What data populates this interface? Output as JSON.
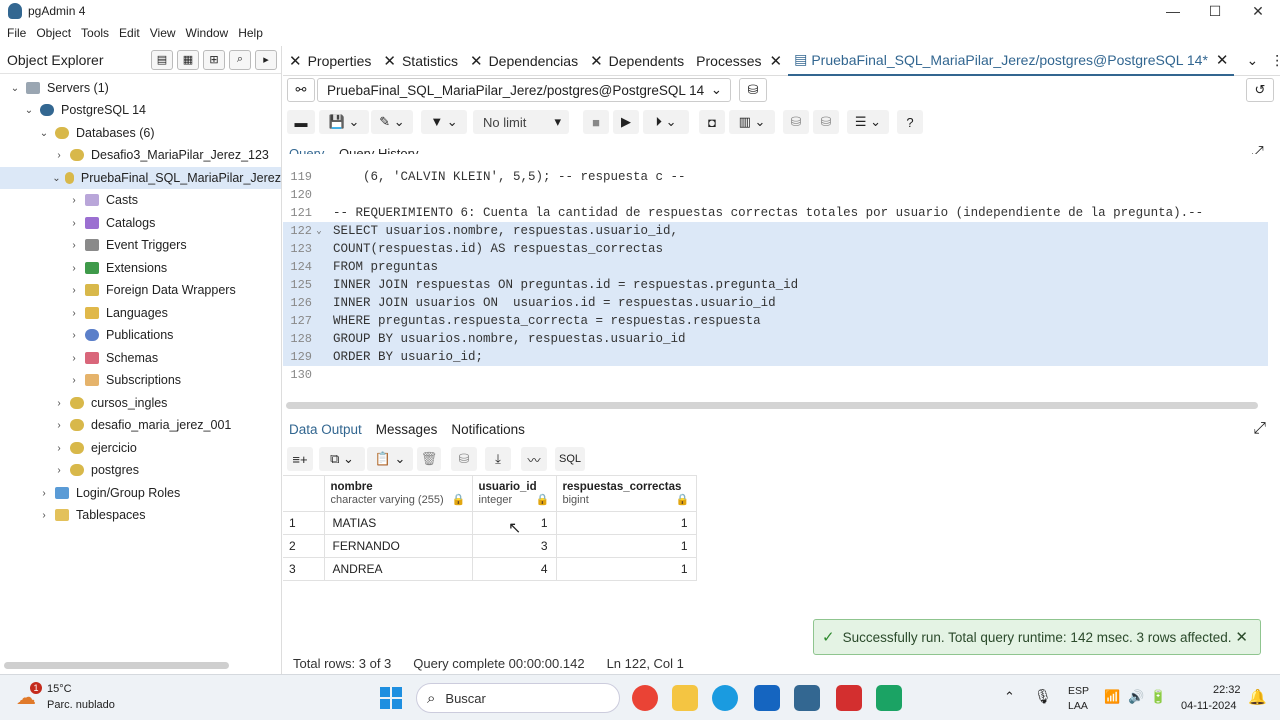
{
  "window": {
    "title": "pgAdmin 4",
    "minimize": "—",
    "maximize": "☐",
    "close": "✕"
  },
  "menu": [
    "File",
    "Object",
    "Tools",
    "Edit",
    "View",
    "Window",
    "Help"
  ],
  "explorer": {
    "label": "Object Explorer"
  },
  "tree": [
    {
      "label": "Servers (1)",
      "chev": "⌄"
    },
    {
      "label": "PostgreSQL 14",
      "chev": "⌄"
    },
    {
      "label": "Databases (6)",
      "chev": "⌄"
    },
    {
      "label": "Desafio3_MariaPilar_Jerez_123",
      "chev": "›"
    },
    {
      "label": "PruebaFinal_SQL_MariaPilar_Jerez",
      "chev": "⌄"
    },
    {
      "label": "Casts",
      "chev": "›"
    },
    {
      "label": "Catalogs",
      "chev": "›"
    },
    {
      "label": "Event Triggers",
      "chev": "›"
    },
    {
      "label": "Extensions",
      "chev": "›"
    },
    {
      "label": "Foreign Data Wrappers",
      "chev": "›"
    },
    {
      "label": "Languages",
      "chev": "›"
    },
    {
      "label": "Publications",
      "chev": "›"
    },
    {
      "label": "Schemas",
      "chev": "›"
    },
    {
      "label": "Subscriptions",
      "chev": "›"
    },
    {
      "label": "cursos_ingles",
      "chev": "›"
    },
    {
      "label": "desafio_maria_jerez_001",
      "chev": "›"
    },
    {
      "label": "ejercicio",
      "chev": "›"
    },
    {
      "label": "postgres",
      "chev": "›"
    },
    {
      "label": "Login/Group Roles",
      "chev": "›"
    },
    {
      "label": "Tablespaces",
      "chev": "›"
    }
  ],
  "tabs": [
    "Properties",
    "Statistics",
    "Dependencias",
    "Dependents",
    "Processes",
    "PruebaFinal_SQL_MariaPilar_Jerez/postgres@PostgreSQL 14*"
  ],
  "connection": "PruebaFinal_SQL_MariaPilar_Jerez/postgres@PostgreSQL 14",
  "limit": "No limit",
  "query_tabs": [
    "Query",
    "Query History"
  ],
  "code": [
    {
      "n": "119",
      "t": "    (6, 'CALVIN KLEIN', 5,5); -- respuesta c --"
    },
    {
      "n": "120",
      "t": ""
    },
    {
      "n": "121",
      "t": "-- REQUERIMIENTO 6: Cuenta la cantidad de respuestas correctas totales por usuario (independiente de la pregunta).--"
    },
    {
      "n": "122",
      "t": "SELECT usuarios.nombre, respuestas.usuario_id,"
    },
    {
      "n": "123",
      "t": "COUNT(respuestas.id) AS respuestas_correctas"
    },
    {
      "n": "124",
      "t": "FROM preguntas"
    },
    {
      "n": "125",
      "t": "INNER JOIN respuestas ON preguntas.id = respuestas.pregunta_id"
    },
    {
      "n": "126",
      "t": "INNER JOIN usuarios ON  usuarios.id = respuestas.usuario_id"
    },
    {
      "n": "127",
      "t": "WHERE preguntas.respuesta_correcta = respuestas.respuesta"
    },
    {
      "n": "128",
      "t": "GROUP BY usuarios.nombre, respuestas.usuario_id"
    },
    {
      "n": "129",
      "t": "ORDER BY usuario_id;"
    },
    {
      "n": "130",
      "t": ""
    }
  ],
  "result_tabs": [
    "Data Output",
    "Messages",
    "Notifications"
  ],
  "sql_label": "SQL",
  "columns": [
    {
      "name": "nombre",
      "type": "character varying (255)"
    },
    {
      "name": "usuario_id",
      "type": "integer"
    },
    {
      "name": "respuestas_correctas",
      "type": "bigint"
    }
  ],
  "rows": [
    {
      "idx": "1",
      "nombre": "MATIAS",
      "usuario_id": "1",
      "respuestas_correctas": "1"
    },
    {
      "idx": "2",
      "nombre": "FERNANDO",
      "usuario_id": "3",
      "respuestas_correctas": "1"
    },
    {
      "idx": "3",
      "nombre": "ANDREA",
      "usuario_id": "4",
      "respuestas_correctas": "1"
    }
  ],
  "toast": "Successfully run. Total query runtime: 142 msec. 3 rows affected.",
  "status": {
    "total": "Total rows: 3 of 3",
    "complete": "Query complete 00:00:00.142",
    "pos": "Ln 122, Col 1"
  },
  "taskbar": {
    "temp": "15°C",
    "weather": "Parc. nublado",
    "search": "Buscar",
    "lang1": "ESP",
    "lang2": "LAA",
    "time": "22:32",
    "date": "04-11-2024",
    "badge": "1"
  }
}
